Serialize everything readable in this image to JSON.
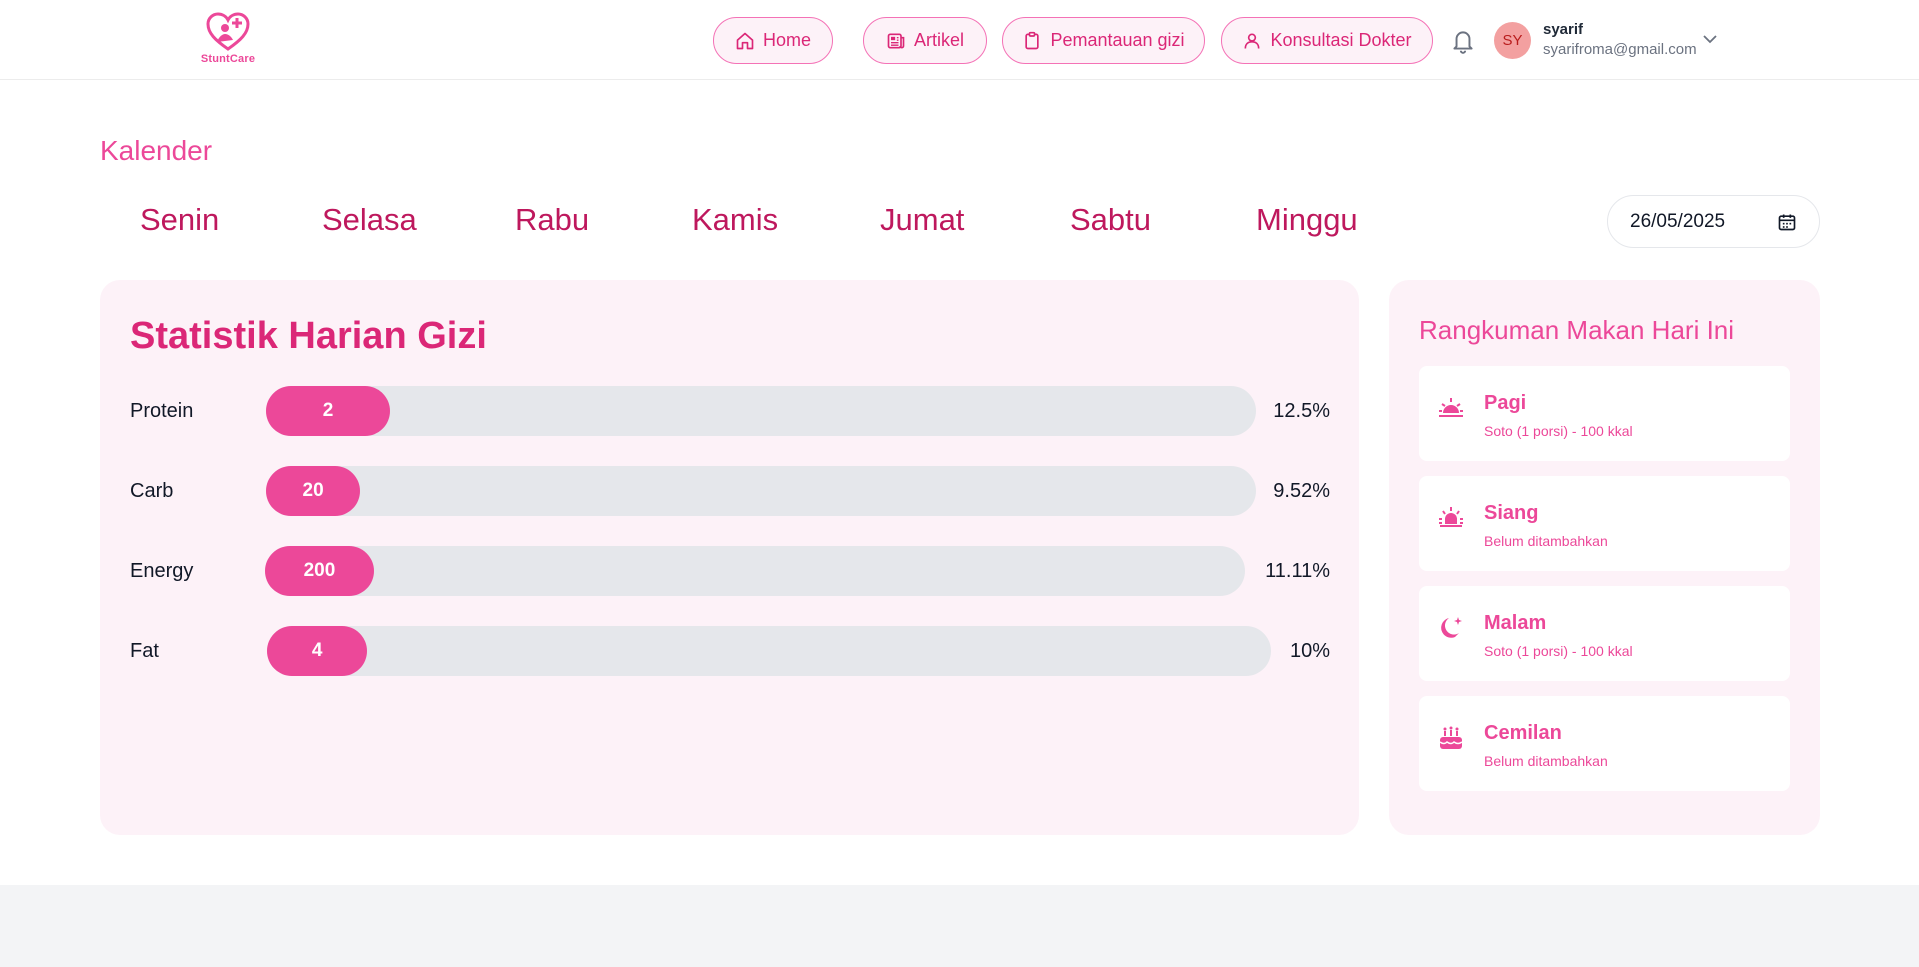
{
  "brand": {
    "name": "StuntCare",
    "color": "#ec4899"
  },
  "nav": {
    "home": "Home",
    "artikel": "Artikel",
    "pemantauan": "Pemantauan gizi",
    "konsultasi": "Konsultasi Dokter"
  },
  "user": {
    "initials": "SY",
    "name": "syarif",
    "email": "syarifroma@gmail.com"
  },
  "calendar": {
    "title": "Kalender",
    "days": [
      "Senin",
      "Selasa",
      "Rabu",
      "Kamis",
      "Jumat",
      "Sabtu",
      "Minggu"
    ],
    "date": "26/05/2025"
  },
  "stats": {
    "title": "Statistik Harian Gizi",
    "rows": [
      {
        "label": "Protein",
        "value": "2",
        "percent": "12.5%",
        "fraction": 0.125
      },
      {
        "label": "Carb",
        "value": "20",
        "percent": "9.52%",
        "fraction": 0.0952
      },
      {
        "label": "Energy",
        "value": "200",
        "percent": "11.11%",
        "fraction": 0.1111
      },
      {
        "label": "Fat",
        "value": "4",
        "percent": "10%",
        "fraction": 0.1
      }
    ]
  },
  "summary": {
    "title": "Rangkuman Makan Hari Ini",
    "meals": [
      {
        "name": "Pagi",
        "desc": "Soto (1 porsi) - 100 kkal",
        "icon": "sunrise-icon"
      },
      {
        "name": "Siang",
        "desc": "Belum ditambahkan",
        "icon": "sun-icon"
      },
      {
        "name": "Malam",
        "desc": "Soto (1 porsi) - 100 kkal",
        "icon": "moon-icon"
      },
      {
        "name": "Cemilan",
        "desc": "Belum ditambahkan",
        "icon": "cake-icon"
      }
    ]
  }
}
